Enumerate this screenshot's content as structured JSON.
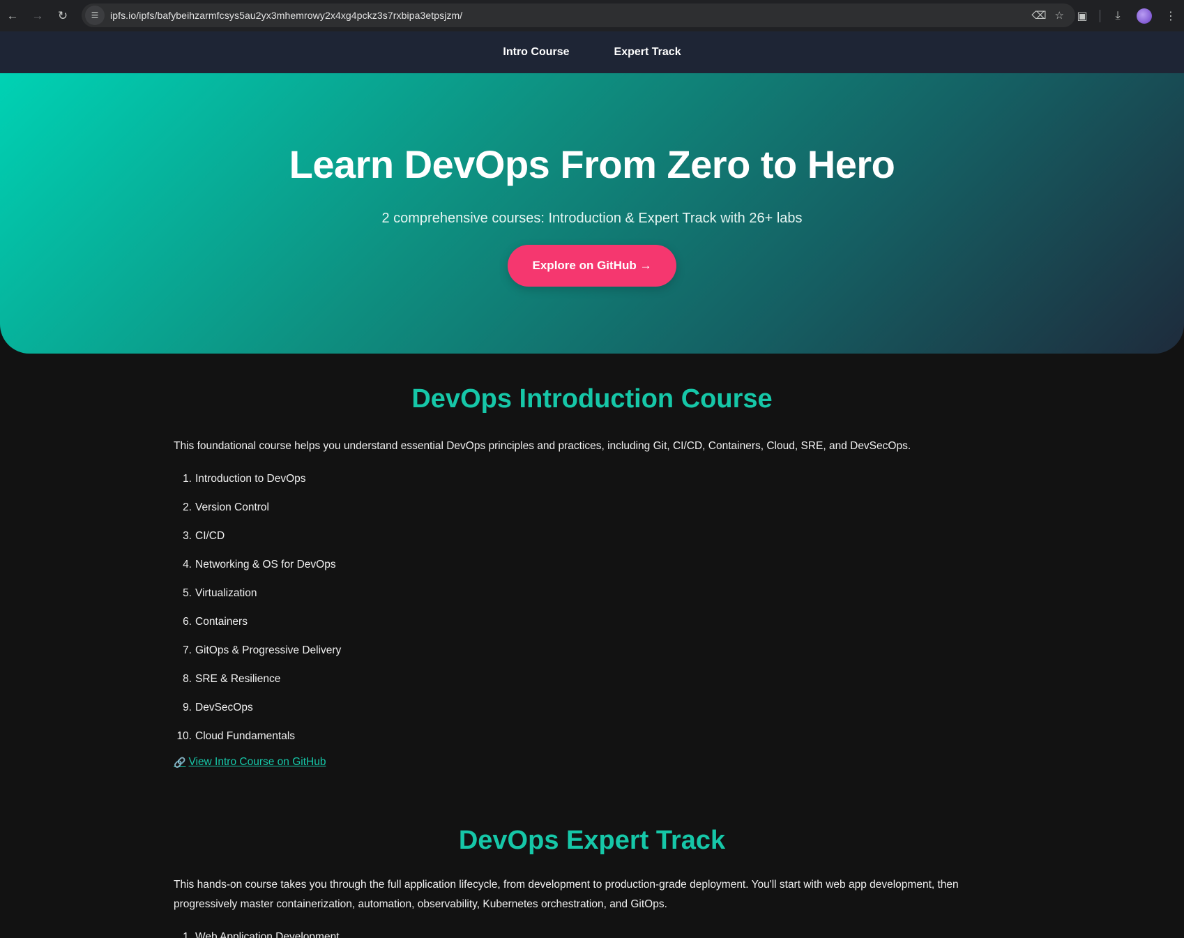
{
  "browser": {
    "url": "ipfs.io/ipfs/bafybeihzarmfcsys5au2yx3mhemrowy2x4xg4pckz3s7rxbipa3etpsjzm/"
  },
  "nav": {
    "items": [
      {
        "label": "Intro Course"
      },
      {
        "label": "Expert Track"
      }
    ]
  },
  "hero": {
    "title": "Learn DevOps From Zero to Hero",
    "subtitle": "2 comprehensive courses: Introduction & Expert Track with 26+ labs",
    "cta_label": "Explore on GitHub →"
  },
  "intro": {
    "heading": "DevOps Introduction Course",
    "description": "This foundational course helps you understand essential DevOps principles and practices, including Git, CI/CD, Containers, Cloud, SRE, and DevSecOps.",
    "modules": [
      {
        "num": "1.",
        "label": "Introduction to DevOps"
      },
      {
        "num": "2.",
        "label": "Version Control"
      },
      {
        "num": "3.",
        "label": "CI/CD"
      },
      {
        "num": "4.",
        "label": "Networking & OS for DevOps"
      },
      {
        "num": "5.",
        "label": "Virtualization"
      },
      {
        "num": "6.",
        "label": "Containers"
      },
      {
        "num": "7.",
        "label": "GitOps & Progressive Delivery"
      },
      {
        "num": "8.",
        "label": "SRE & Resilience"
      },
      {
        "num": "9.",
        "label": "DevSecOps"
      },
      {
        "num": "10.",
        "label": "Cloud Fundamentals"
      }
    ],
    "link_label": "View Intro Course on GitHub"
  },
  "expert": {
    "heading": "DevOps Expert Track",
    "description": "This hands-on course takes you through the full application lifecycle, from development to production-grade deployment. You'll start with web app development, then progressively master containerization, automation, observability, Kubernetes orchestration, and GitOps.",
    "modules": [
      {
        "num": "1.",
        "label": "Web Application Development"
      }
    ]
  },
  "colors": {
    "accent": "#16c7a8",
    "cta": "#f5376f",
    "nav_bg": "#1e2535",
    "page_bg": "#121212"
  }
}
